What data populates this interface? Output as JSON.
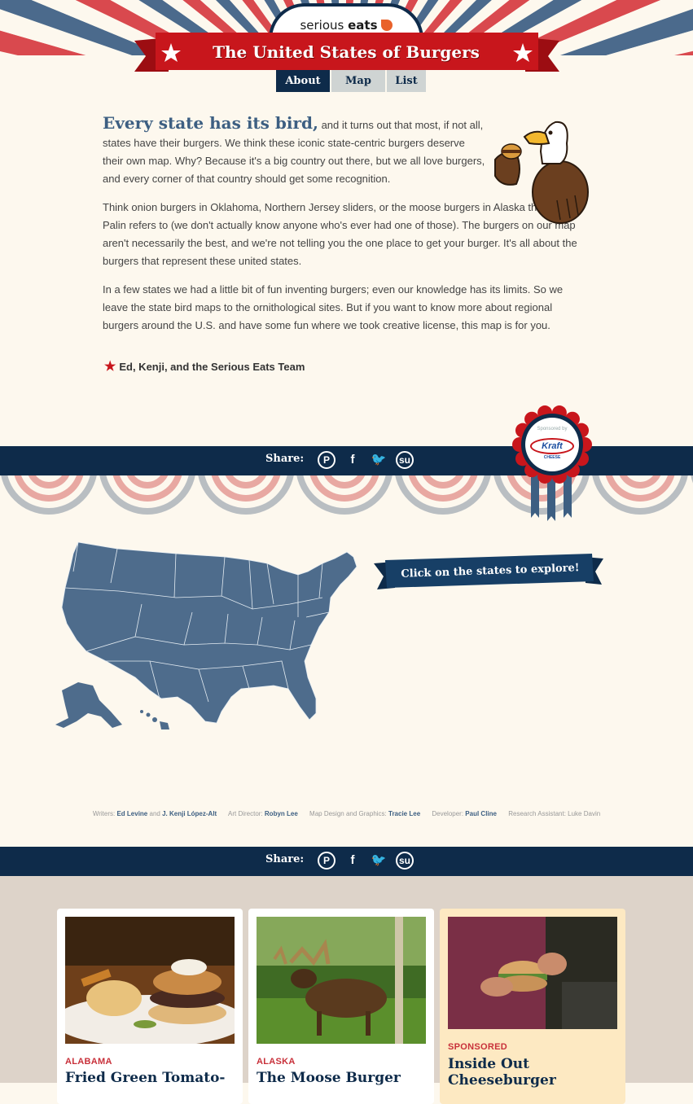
{
  "header": {
    "logo_text_plain": "serious",
    "logo_text_bold": "eats",
    "title": "The United States of Burgers"
  },
  "tabs": [
    {
      "label": "About",
      "active": true
    },
    {
      "label": "Map",
      "active": false
    },
    {
      "label": "List",
      "active": false
    }
  ],
  "intro": {
    "lead": "Every state has its bird,",
    "p1_rest": " and it turns out that most, if not all, states have their burgers. We think these iconic state-centric burgers deserve their own map. Why? Because it's a big country out there, but we all love burgers, and every corner of that country should get some recognition.",
    "p2": "Think onion burgers in Oklahoma, Northern Jersey sliders, or the moose burgers in Alaska that Sarah Palin refers to (we don't actually know anyone who's ever had one of those). The burgers on our map aren't necessarily the best, and we're not telling you the one place to get your burger. It's all about the burgers that represent these united states.",
    "p3": "In a few states we had a little bit of fun inventing burgers; even our knowledge has its limits. So we leave the state bird maps to the ornithological sites. But if you want to know more about regional burgers around the U.S. and have some fun where we took creative license, this map is for you.",
    "signature": "Ed, Kenji, and the Serious Eats Team"
  },
  "share": {
    "label": "Share:",
    "icons": [
      "pinterest-icon",
      "facebook-icon",
      "twitter-icon",
      "stumbleupon-icon"
    ]
  },
  "sponsor": {
    "sponsored_by": "Sponsored by",
    "brand": "Kraft",
    "sub": "CHEESE"
  },
  "map": {
    "cta": "Click on the states to explore!"
  },
  "credits": {
    "writers_label": "Writers:",
    "writer1": "Ed Levine",
    "and": "and",
    "writer2": "J. Kenji López-Alt",
    "art_label": "Art Director:",
    "art": "Robyn Lee",
    "design_label": "Map Design and Graphics:",
    "design": "Tracie Lee",
    "dev_label": "Developer:",
    "dev": "Paul Cline",
    "research": "Research Assistant: Luke Davin"
  },
  "cards": [
    {
      "kicker": "ALABAMA",
      "title": "Fried Green Tomato-",
      "image": "burger-plate-photo"
    },
    {
      "kicker": "ALASKA",
      "title": "The Moose Burger",
      "image": "moose-photo"
    },
    {
      "kicker": "SPONSORED",
      "title": "Inside Out Cheeseburger",
      "image": "grilled-burger-photo"
    }
  ],
  "colors": {
    "navy": "#0e2b4a",
    "red": "#c8161c",
    "map_blue": "#4e6c8c",
    "cream": "#fdf8ee"
  }
}
